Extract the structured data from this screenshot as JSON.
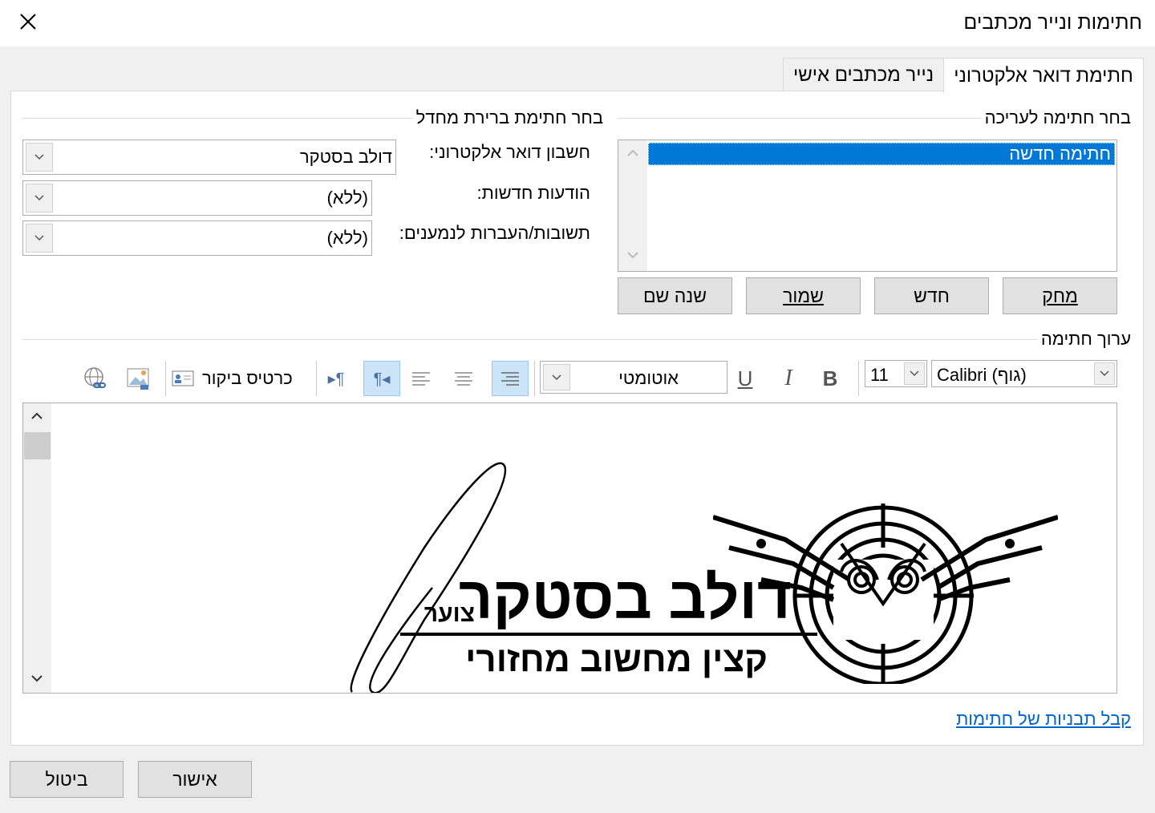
{
  "window": {
    "title": "חתימות ונייר מכתבים"
  },
  "tabs": [
    {
      "label": "חתימת דואר אלקטרוני",
      "active": true
    },
    {
      "label": "נייר מכתבים אישי",
      "active": false
    }
  ],
  "select_signature": {
    "label": "בחר חתימה לעריכה",
    "items": [
      "חתימה חדשה"
    ],
    "selected_index": 0
  },
  "default_signature": {
    "label": "בחר חתימת ברירת מחדל",
    "email_account_label": "חשבון דואר אלקטרוני:",
    "email_account_value": "דולב בסטקר",
    "new_messages_label": "הודעות חדשות:",
    "new_messages_value": "(ללא)",
    "replies_label": "תשובות/העברות לנמענים:",
    "replies_value": "(ללא)"
  },
  "signature_buttons": {
    "delete": "מחק",
    "new": "חדש",
    "save": "שמור",
    "rename": "שנה שם"
  },
  "edit_signature": {
    "label": "ערוך חתימה",
    "font": "Calibri (גוף)",
    "size": "11",
    "color": "אוטומטי",
    "business_card": "כרטיס ביקור"
  },
  "signature_content": {
    "name": "דולב בסטקר",
    "rank": "צוער",
    "title": "קצין מחשוב מחזורי"
  },
  "link": "קבל תבניות של חתימות",
  "footer": {
    "ok": "אישור",
    "cancel": "ביטול"
  },
  "colors": {
    "accent": "#0078d7",
    "link": "#0066cc",
    "pressed": "#cce4f7"
  }
}
